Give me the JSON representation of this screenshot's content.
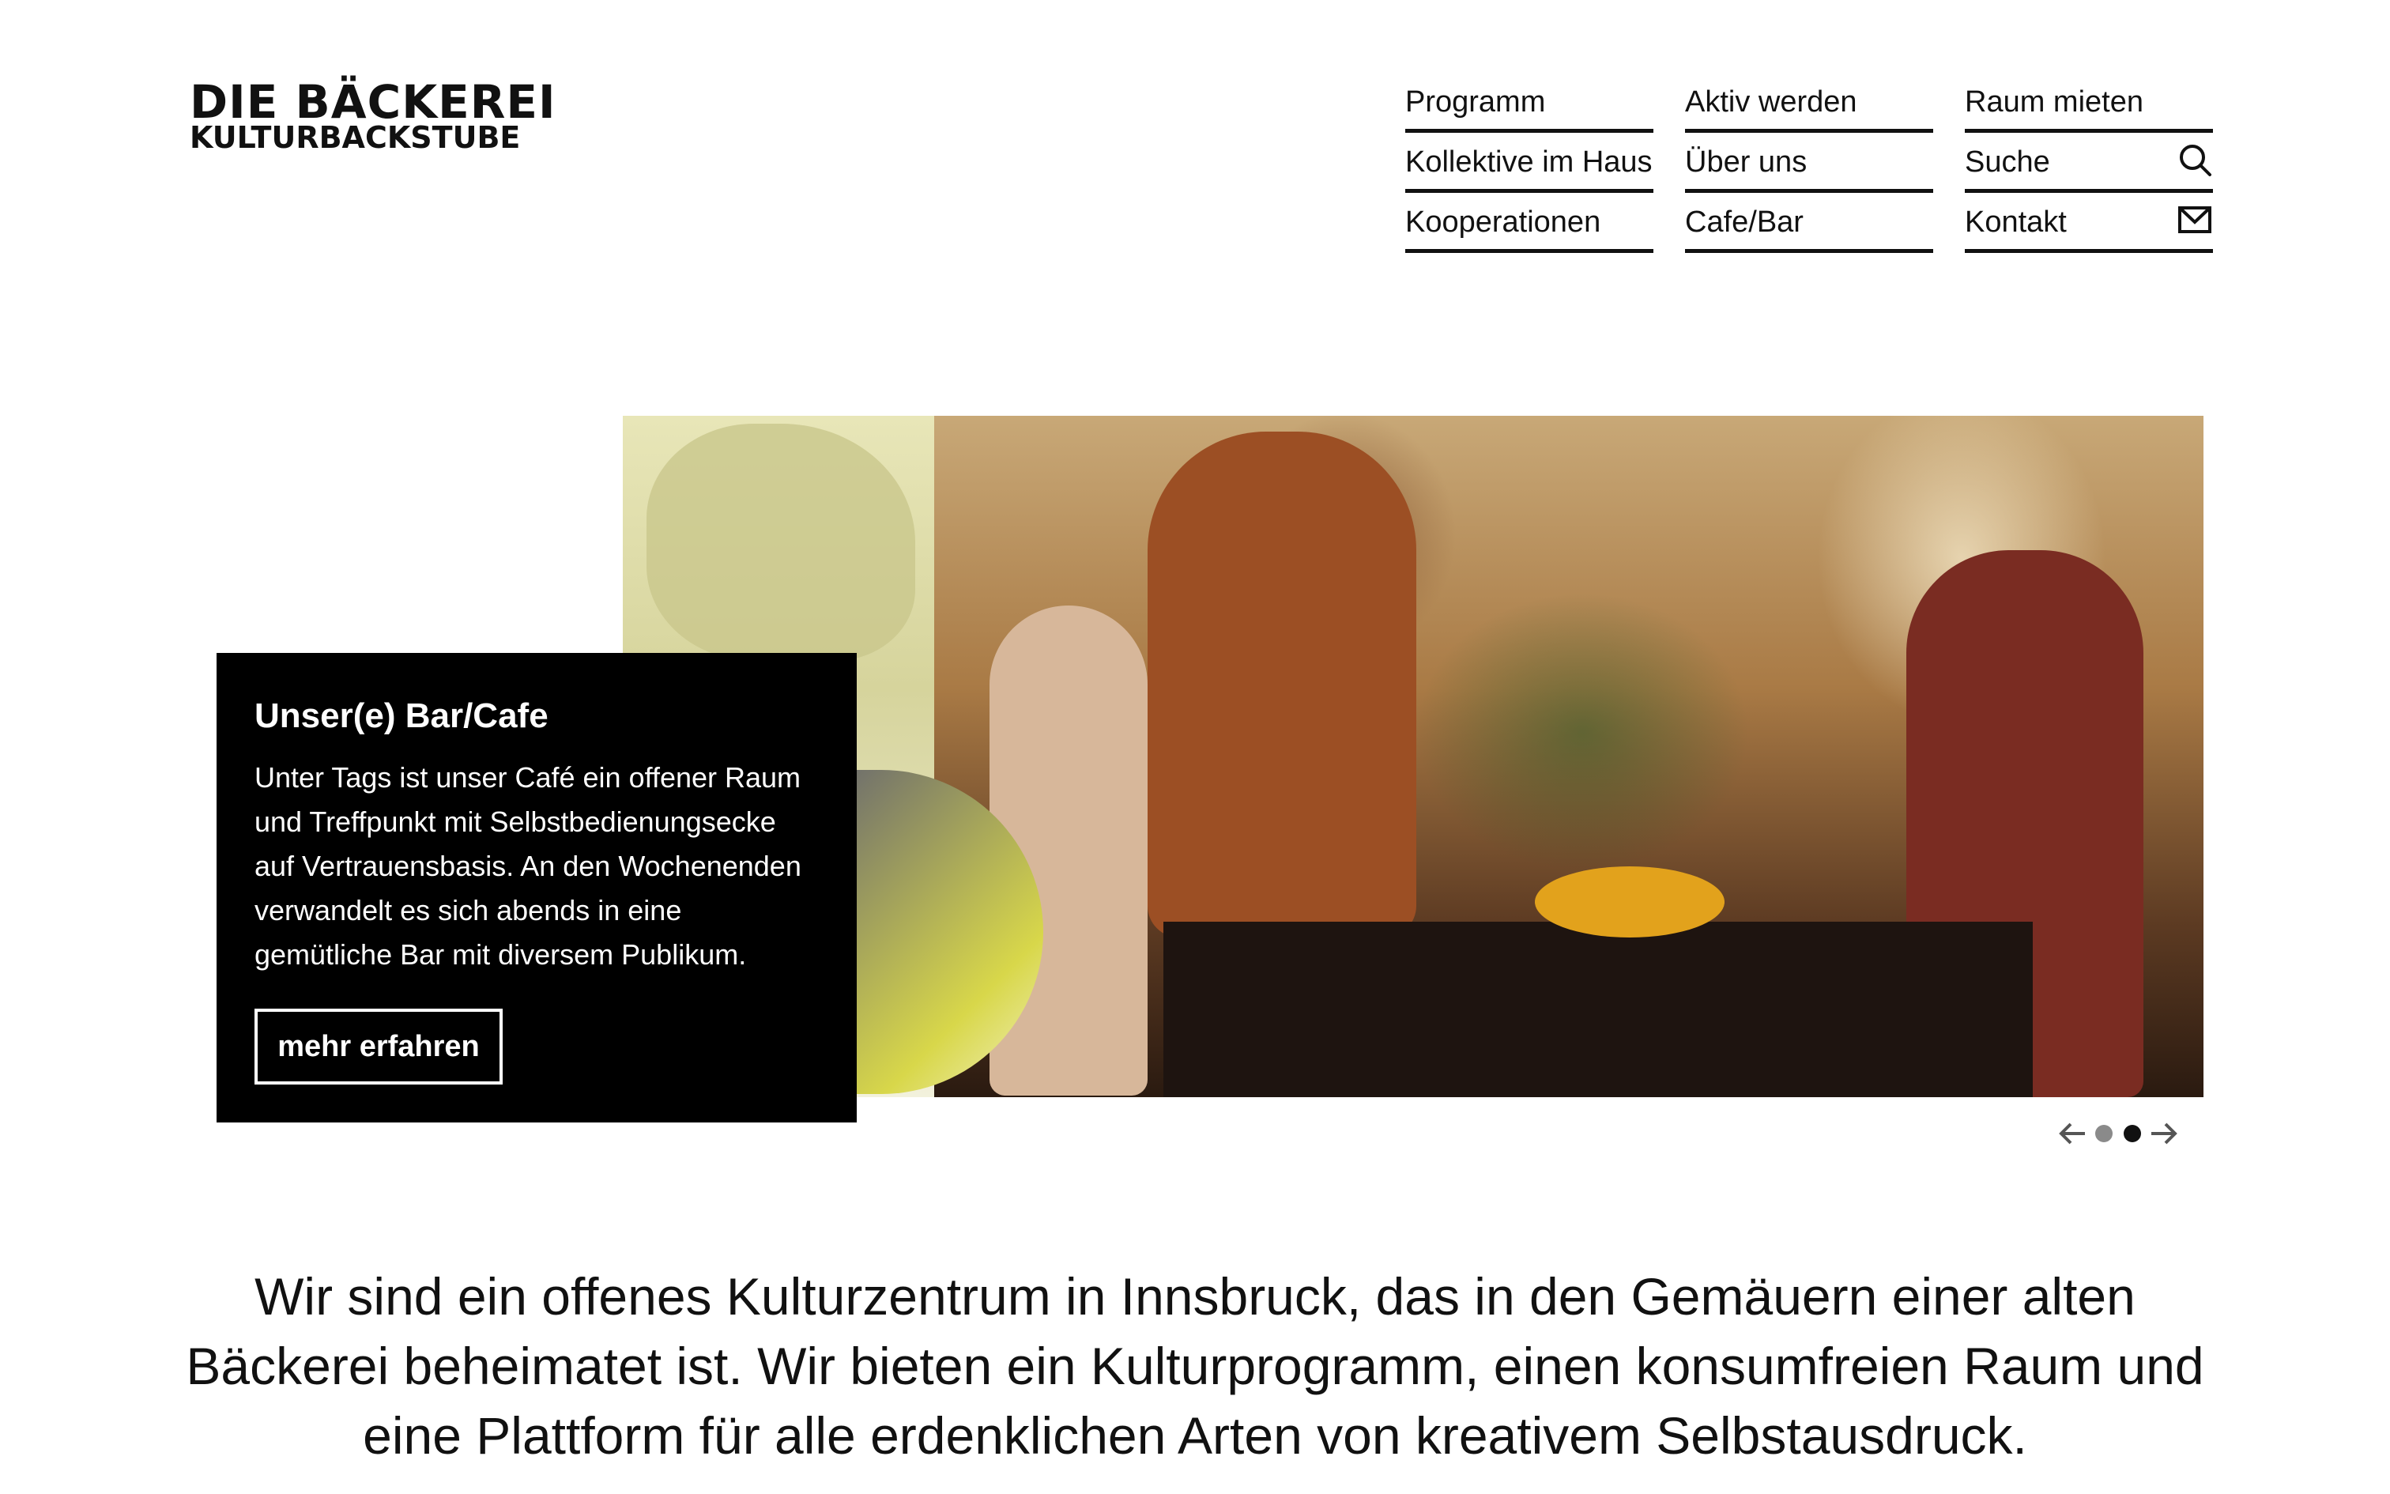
{
  "logo": {
    "line1": "DIE BÄCKEREI",
    "line2": "KULTURBACKSTUBE"
  },
  "nav": {
    "items": [
      {
        "label": "Programm"
      },
      {
        "label": "Aktiv werden"
      },
      {
        "label": "Raum mieten"
      },
      {
        "label": "Kollektive im Haus"
      },
      {
        "label": "Über uns"
      },
      {
        "label": "Suche",
        "icon": "search-icon"
      },
      {
        "label": "Kooperationen"
      },
      {
        "label": "Cafe/Bar"
      },
      {
        "label": "Kontakt",
        "icon": "mail-icon"
      }
    ]
  },
  "slider": {
    "title": "Unser(e) Bar/Cafe",
    "text": "Unter Tags ist unser Café ein offener Raum und Treffpunkt mit Selbstbedienungsecke auf Vertrauensbasis. An den Wochenenden verwandelt es sich abends in eine gemütliche Bar mit diversem Publikum.",
    "button_label": "mehr erfahren",
    "slide_count": 2,
    "active_slide": 2
  },
  "intro": {
    "text": "Wir sind ein offenes Kulturzentrum in Innsbruck, das in den Gemäuern einer alten Bäckerei beheimatet ist. Wir bieten ein Kulturprogramm, einen konsumfreien Raum und eine Plattform für alle erdenklichen Arten von kreativem Selbstausdruck."
  }
}
